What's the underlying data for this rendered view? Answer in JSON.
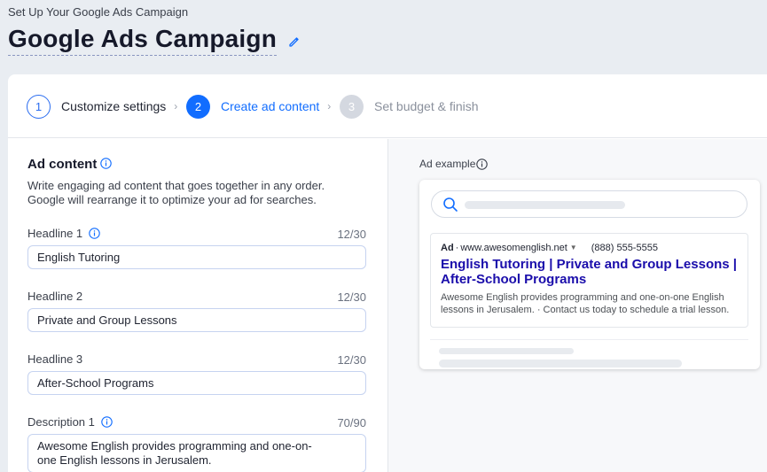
{
  "header": {
    "breadcrumb": "Set Up Your Google Ads Campaign",
    "title": "Google Ads Campaign"
  },
  "steps": [
    {
      "number": "1",
      "label": "Customize settings",
      "state": "completed"
    },
    {
      "number": "2",
      "label": "Create ad content",
      "state": "active"
    },
    {
      "number": "3",
      "label": "Set budget & finish",
      "state": "upcoming"
    }
  ],
  "ad_content": {
    "title": "Ad content",
    "description": "Write engaging ad content that goes together in any order. Google will rearrange it to optimize your ad for searches.",
    "fields": [
      {
        "label": "Headline 1",
        "counter": "12/30",
        "value": "English Tutoring",
        "has_info": true
      },
      {
        "label": "Headline 2",
        "counter": "12/30",
        "value": "Private and Group Lessons",
        "has_info": false
      },
      {
        "label": "Headline 3",
        "counter": "12/30",
        "value": "After-School Programs",
        "has_info": false
      },
      {
        "label": "Description 1",
        "counter": "70/90",
        "value": "Awesome English provides programming and one-on-one English lessons in Jerusalem.",
        "has_info": true
      }
    ]
  },
  "ad_example": {
    "label": "Ad example",
    "badge": "Ad",
    "url": "www.awesomenglish.net",
    "phone": "(888) 555-5555",
    "headline": "English Tutoring | Private and Group Lessons | After-School Programs",
    "description": "Awesome English provides programming and one-on-one English lessons in Jerusalem. · Contact us today to schedule a trial lesson."
  },
  "colors": {
    "accent": "#116dff",
    "ad_headline": "#1a0dab",
    "background": "#e9edf2"
  }
}
